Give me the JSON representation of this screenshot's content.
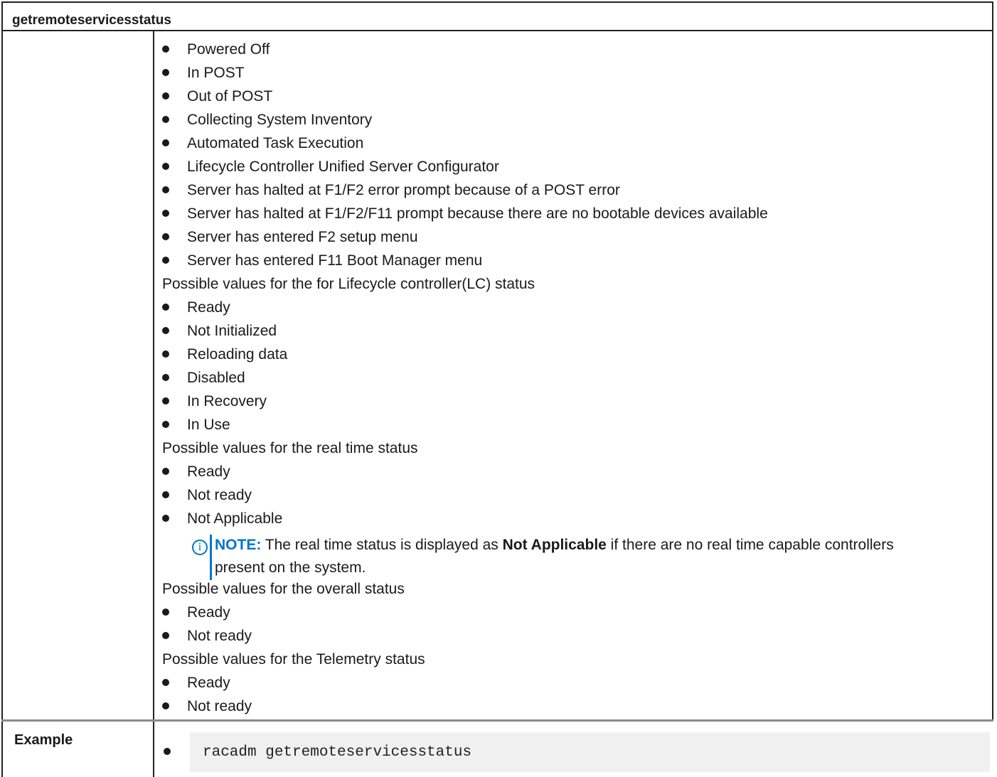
{
  "header": {
    "title": "getremoteservicesstatus"
  },
  "content": {
    "server_status_values": [
      "Powered Off",
      "In POST",
      "Out of POST",
      "Collecting System Inventory",
      "Automated Task Execution",
      "Lifecycle Controller Unified Server Configurator",
      "Server has halted at F1/F2 error prompt because of a POST error",
      "Server has halted at F1/F2/F11 prompt because there are no bootable devices available",
      "Server has entered F2 setup menu",
      "Server has entered F11 Boot Manager menu"
    ],
    "lc_heading": "Possible values for the for Lifecycle controller(LC) status",
    "lc_values": [
      "Ready",
      "Not Initialized",
      "Reloading data",
      "Disabled",
      "In Recovery",
      "In Use"
    ],
    "realtime_heading": "Possible values for the real time status",
    "realtime_values": [
      "Ready",
      "Not ready",
      "Not Applicable"
    ],
    "note": {
      "label": "NOTE:",
      "text_before": " The real time status is displayed as ",
      "bold": "Not Applicable",
      "text_after": " if there are no real time capable controllers present on the system."
    },
    "overall_heading": "Possible values for the overall status",
    "overall_values": [
      "Ready",
      "Not ready"
    ],
    "telemetry_heading": "Possible values for the Telemetry status",
    "telemetry_values": [
      "Ready",
      "Not ready"
    ]
  },
  "example": {
    "label": "Example",
    "code": "racadm getremoteservicesstatus"
  },
  "colors": {
    "note_accent": "#0076ce",
    "code_bg": "#f0f0f0"
  },
  "icons": {
    "note": "info-circle-icon",
    "bullet": "bullet-icon"
  }
}
